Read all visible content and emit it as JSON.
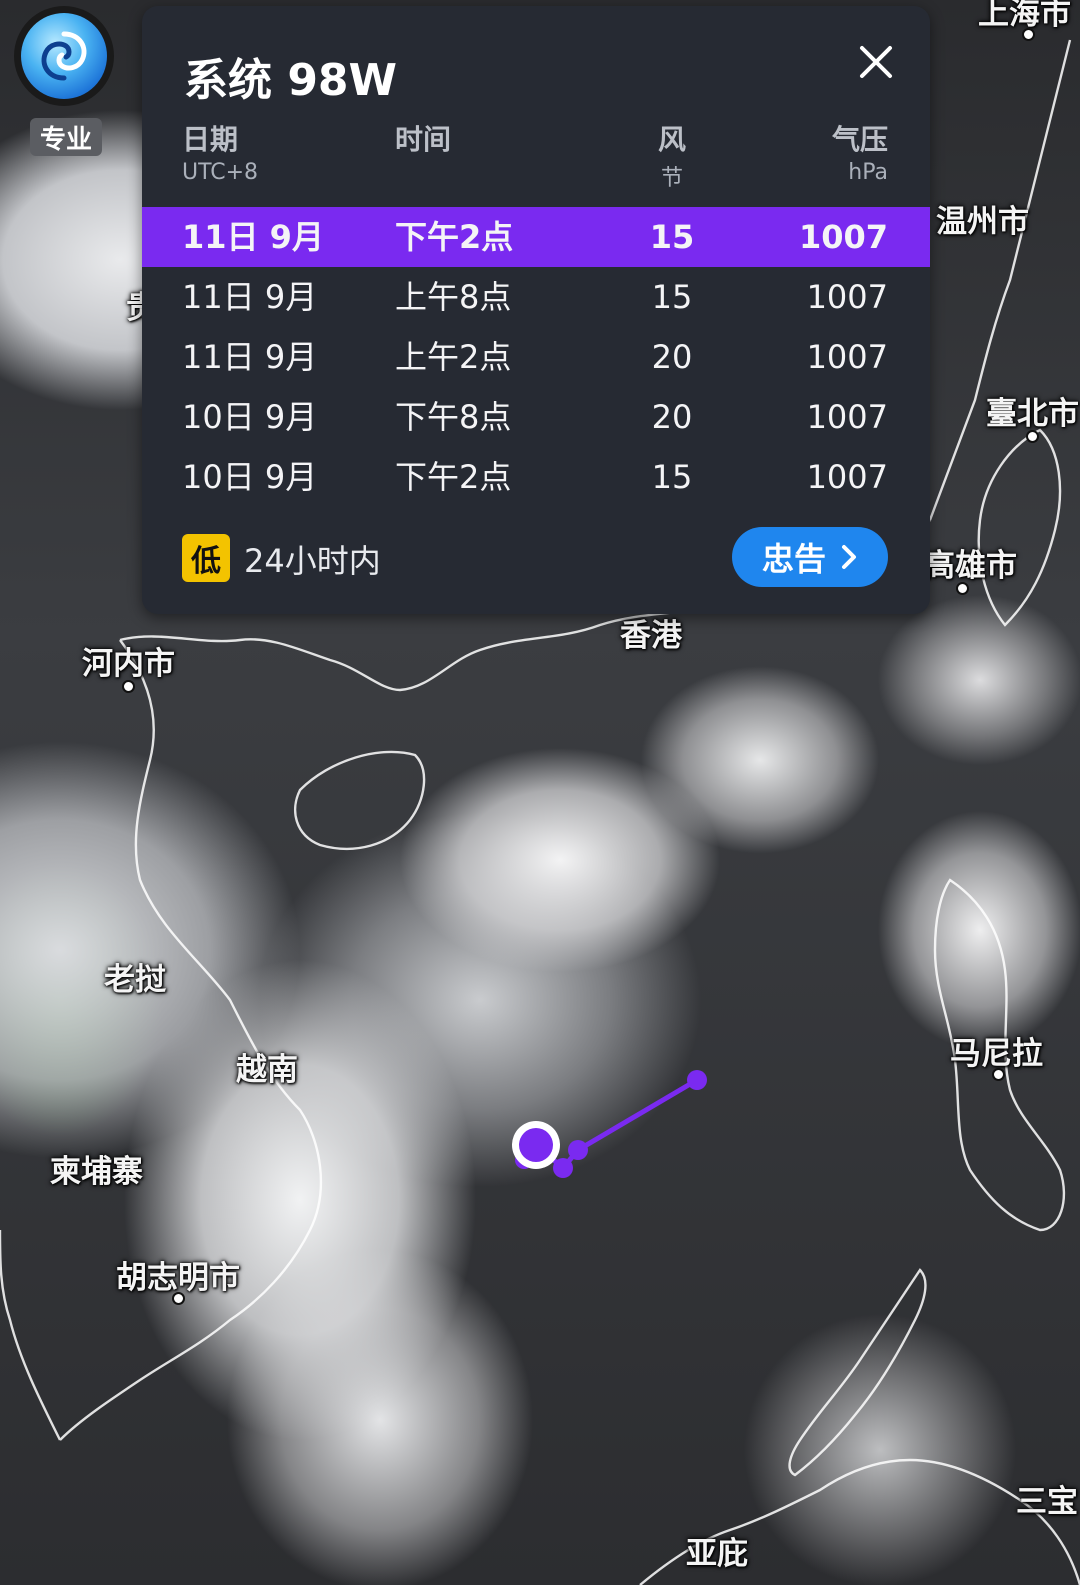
{
  "app": {
    "logo_icon": "typhoon-swirl-icon",
    "pro_badge": "专业"
  },
  "map": {
    "places": [
      {
        "id": "shanghai",
        "label": "上海市"
      },
      {
        "id": "wenzhou",
        "label": "温州市"
      },
      {
        "id": "taipei",
        "label": "臺北市"
      },
      {
        "id": "kaohsiung",
        "label": "高雄市"
      },
      {
        "id": "hanoi",
        "label": "河内市"
      },
      {
        "id": "hongkong",
        "label": "香港"
      },
      {
        "id": "laos",
        "label": "老挝"
      },
      {
        "id": "vietnam",
        "label": "越南"
      },
      {
        "id": "cambodia",
        "label": "柬埔寨"
      },
      {
        "id": "hcmc",
        "label": "胡志明市"
      },
      {
        "id": "manila",
        "label": "马尼拉"
      },
      {
        "id": "sanbao",
        "label": "三宝"
      },
      {
        "id": "yabi",
        "label": "亚庇"
      },
      {
        "id": "gui",
        "label": "贵"
      }
    ]
  },
  "panel": {
    "title": "系统 98W",
    "close_icon": "close-icon",
    "headers": {
      "date": "日期",
      "date_unit": "UTC+8",
      "time": "时间",
      "wind": "风",
      "wind_unit": "节",
      "pressure": "气压",
      "pressure_unit": "hPa"
    },
    "rows": [
      {
        "date": "11日 9月",
        "time": "下午2点",
        "wind": "15",
        "pressure": "1007",
        "active": true
      },
      {
        "date": "11日 9月",
        "time": "上午8点",
        "wind": "15",
        "pressure": "1007",
        "active": false
      },
      {
        "date": "11日 9月",
        "time": "上午2点",
        "wind": "20",
        "pressure": "1007",
        "active": false
      },
      {
        "date": "10日 9月",
        "time": "下午8点",
        "wind": "20",
        "pressure": "1007",
        "active": false
      },
      {
        "date": "10日 9月",
        "time": "下午2点",
        "wind": "15",
        "pressure": "1007",
        "active": false
      }
    ],
    "level_badge": "低",
    "level_text": "24小时内",
    "advisory_label": "忠告",
    "advisory_icon": "chevron-right-icon"
  },
  "colors": {
    "panel_bg": "#262a33",
    "active_row": "#7a2af0",
    "advisory_btn": "#1f86ee",
    "level_badge": "#f3c300",
    "track": "#7a2af0"
  }
}
